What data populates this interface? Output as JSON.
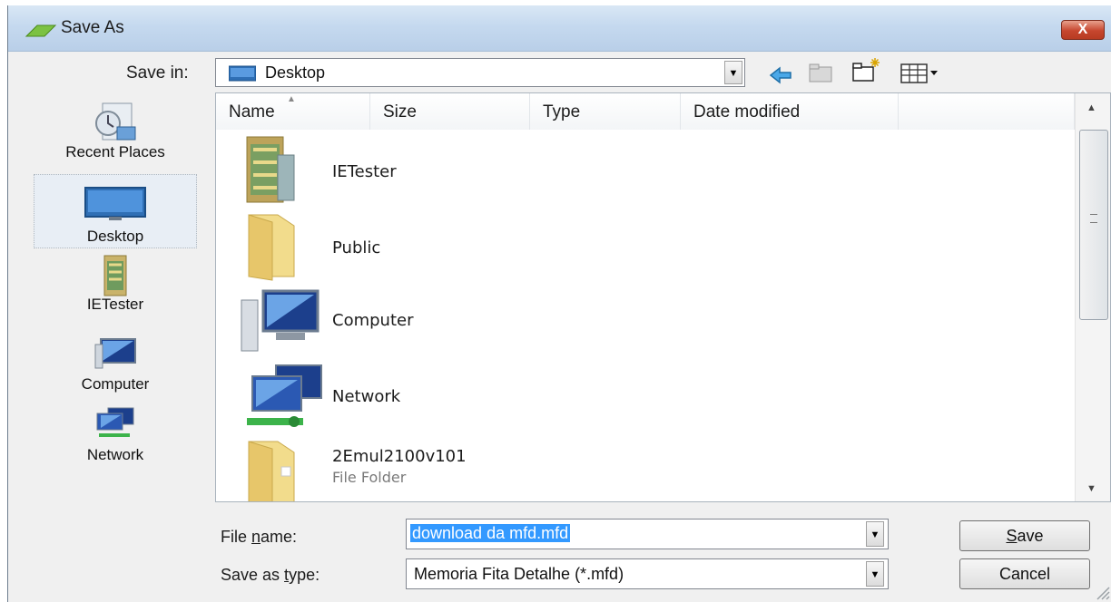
{
  "window": {
    "title": "Save As",
    "close_label": "X"
  },
  "save_in": {
    "label": "Save in:",
    "value": "Desktop"
  },
  "places": [
    {
      "label": "Recent Places",
      "icon": "recent-places-icon"
    },
    {
      "label": "Desktop",
      "icon": "desktop-icon",
      "selected": true
    },
    {
      "label": "IETester",
      "icon": "ietester-folder-icon"
    },
    {
      "label": "Computer",
      "icon": "computer-icon"
    },
    {
      "label": "Network",
      "icon": "network-icon"
    }
  ],
  "columns": [
    {
      "label": "Name"
    },
    {
      "label": "Size"
    },
    {
      "label": "Type"
    },
    {
      "label": "Date modified"
    }
  ],
  "files": [
    {
      "name": "IETester",
      "sub": "",
      "icon": "ietester-folder-icon"
    },
    {
      "name": "Public",
      "sub": "",
      "icon": "folder-icon"
    },
    {
      "name": "Computer",
      "sub": "",
      "icon": "computer-icon"
    },
    {
      "name": "Network",
      "sub": "",
      "icon": "network-icon"
    },
    {
      "name": "2Emul2100v101",
      "sub": "File Folder",
      "icon": "folder-icon"
    }
  ],
  "file_name": {
    "label_pre": "File ",
    "label_underline": "n",
    "label_post": "ame:",
    "value": "download da mfd.mfd"
  },
  "save_type": {
    "label_pre": "Save as ",
    "label_underline": "t",
    "label_post": "ype:",
    "value": "Memoria Fita Detalhe (*.mfd)"
  },
  "buttons": {
    "save_underline": "S",
    "save_rest": "ave",
    "cancel": "Cancel"
  },
  "colors": {
    "selection": "#3399ff",
    "titlebar": "#c5d9ef",
    "close": "#c6462e"
  }
}
